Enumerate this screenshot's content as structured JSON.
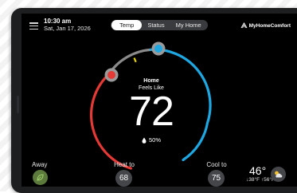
{
  "header": {
    "time": "10:30 am",
    "date": "Sat, Jan 17, 2026",
    "tabs": [
      {
        "label": "Temp",
        "active": true
      },
      {
        "label": "Status",
        "active": false
      },
      {
        "label": "My Home",
        "active": false
      }
    ],
    "brand": "MyHomeComfort"
  },
  "dial": {
    "zone_label": "Home",
    "feels_label": "Feels Like",
    "current_temp": "72",
    "humidity": "50%",
    "heat_color": "#e53935",
    "cool_color": "#1ea7e1",
    "indicator_color": "#e6d400"
  },
  "controls": {
    "away_label": "Away",
    "heat_label": "Heat to",
    "heat_value": "68",
    "cool_label": "Cool to",
    "cool_value": "75"
  },
  "weather": {
    "outdoor_temp": "46°",
    "low": "↓38°F",
    "high": "↑56°F"
  }
}
